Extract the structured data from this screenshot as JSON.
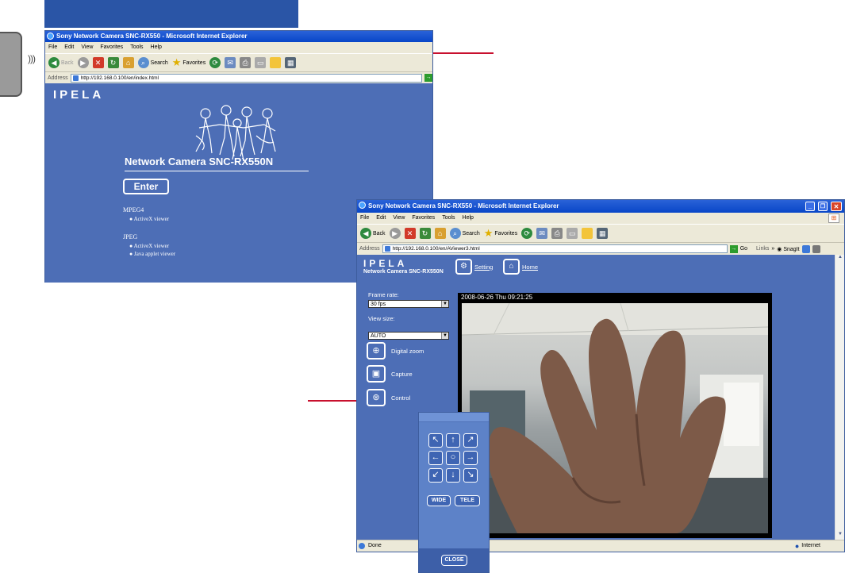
{
  "window1": {
    "title": "Sony Network Camera SNC-RX550 - Microsoft Internet Explorer",
    "menu": [
      "File",
      "Edit",
      "View",
      "Favorites",
      "Tools",
      "Help"
    ],
    "toolbar": {
      "back": "Back",
      "search": "Search",
      "favorites": "Favorites"
    },
    "address_label": "Address",
    "url": "http://192.168.0.100/en/index.html",
    "logo": "IPELA",
    "product_title": "Network Camera SNC-RX550N",
    "enter_button": "Enter",
    "mpeg4_heading": "MPEG4",
    "mpeg4_options": [
      "ActiveX viewer"
    ],
    "jpeg_heading": "JPEG",
    "jpeg_options": [
      "ActiveX viewer",
      "Java applet viewer"
    ]
  },
  "window2": {
    "title": "Sony Network Camera SNC-RX550 - Microsoft Internet Explorer",
    "menu": [
      "File",
      "Edit",
      "View",
      "Favorites",
      "Tools",
      "Help"
    ],
    "toolbar": {
      "back": "Back",
      "search": "Search",
      "favorites": "Favorites"
    },
    "address_label": "Address",
    "url": "http://192.168.0.100/en/AViewer3.html",
    "go_label": "Go",
    "links_label": "Links",
    "snagit_label": "SnagIt",
    "logo": "IPELA",
    "product_subtitle": "Network Camera SNC-RX550N",
    "setting_link": "Setting",
    "home_link": "Home",
    "frame_rate_label": "Frame rate:",
    "frame_rate_value": "30 fps",
    "view_size_label": "View size:",
    "view_size_value": "AUTO",
    "digital_zoom_label": "Digital zoom",
    "capture_label": "Capture",
    "control_label": "Control",
    "timestamp": "2008-06-26 Thu 09:21:25",
    "status_done": "Done",
    "status_zone": "Internet"
  },
  "control_panel": {
    "arrows": [
      "↖",
      "↑",
      "↗",
      "←",
      "○",
      "→",
      "↙",
      "↓",
      "↘"
    ],
    "wide_label": "WIDE",
    "tele_label": "TELE",
    "close_label": "CLOSE"
  }
}
